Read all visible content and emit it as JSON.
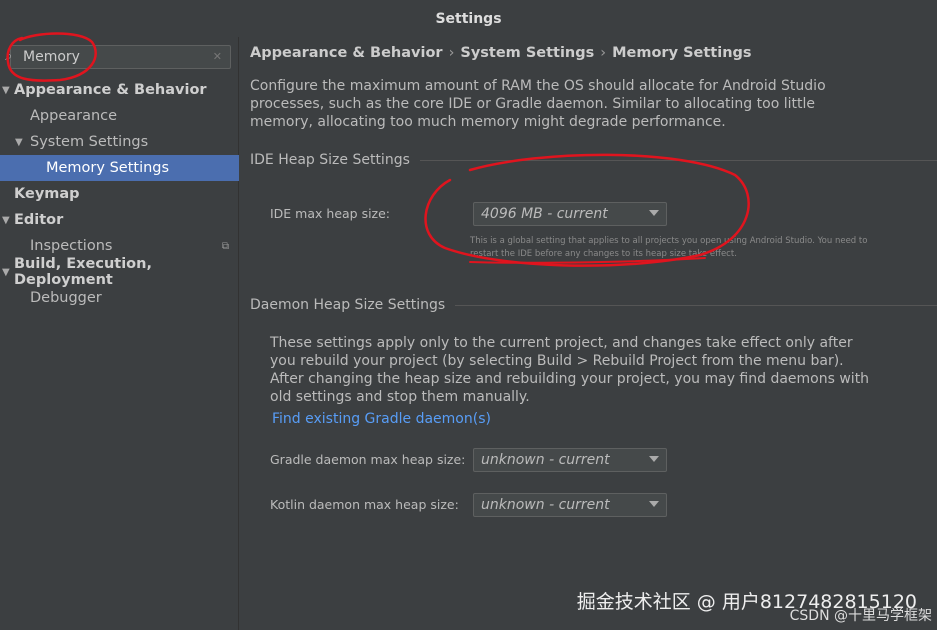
{
  "window": {
    "title": "Settings"
  },
  "search": {
    "value": "Memory",
    "icon": "search-icon",
    "clear_icon": "clear-icon"
  },
  "tree": {
    "appearance_behavior": "Appearance & Behavior",
    "appearance": "Appearance",
    "system_settings": "System Settings",
    "memory_settings": "Memory Settings",
    "keymap": "Keymap",
    "editor": "Editor",
    "inspections": "Inspections",
    "build": "Build, Execution, Deployment",
    "debugger": "Debugger"
  },
  "breadcrumb": {
    "item1": "Appearance & Behavior",
    "item2": "System Settings",
    "item3": "Memory Settings",
    "separator": "›"
  },
  "description": "Configure the maximum amount of RAM the OS should allocate for Android Studio processes, such as the core IDE or Gradle daemon. Similar to allocating too little memory, allocating too much memory might degrade performance.",
  "ide_section": {
    "title": "IDE Heap Size Settings",
    "label": "IDE max heap size:",
    "value": "4096 MB - current",
    "hint": "This is a global setting that applies to all projects you open using Android Studio. You need to restart the IDE before any changes to its heap size take effect."
  },
  "daemon_section": {
    "title": "Daemon Heap Size Settings",
    "description": "These settings apply only to the current project, and changes take effect only after you rebuild your project (by selecting Build > Rebuild Project from the menu bar). After changing the heap size and rebuilding your project, you may find daemons with old settings and stop them manually.",
    "link": "Find existing Gradle daemon(s)",
    "gradle_label": "Gradle daemon max heap size:",
    "gradle_value": "unknown - current",
    "kotlin_label": "Kotlin daemon max heap size:",
    "kotlin_value": "unknown - current"
  },
  "watermark": {
    "line1": "掘金技术社区 @ 用户8127482815120",
    "line2": "CSDN @十里马学框架"
  },
  "colors": {
    "accent": "#4b6eaf",
    "link": "#589df6",
    "annotation": "#e0141e"
  }
}
